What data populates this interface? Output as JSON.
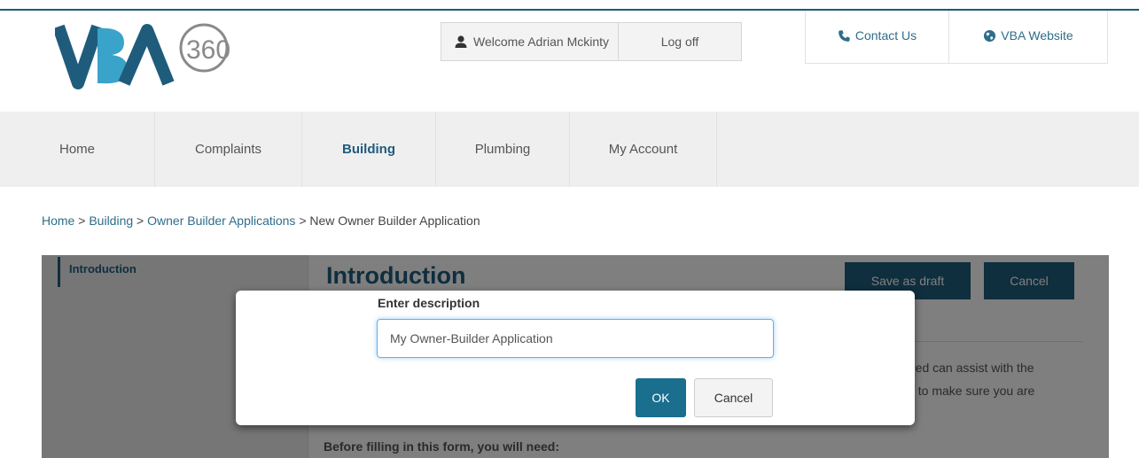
{
  "logo": {
    "text": "VBA",
    "suffix": "360",
    "colors": {
      "primary": "#1f5c7c",
      "secondary": "#3aa3c9",
      "ring": "#7a7a7a"
    }
  },
  "user": {
    "welcome": "Welcome Adrian Mckinty",
    "logoff": "Log off",
    "icon": "user-icon"
  },
  "toplinks": [
    {
      "label": "Contact Us",
      "icon": "phone-icon"
    },
    {
      "label": "VBA Website",
      "icon": "globe-icon"
    }
  ],
  "nav": [
    {
      "label": "Home",
      "active": false
    },
    {
      "label": "Complaints",
      "active": false
    },
    {
      "label": "Building",
      "active": true
    },
    {
      "label": "Plumbing",
      "active": false
    },
    {
      "label": "My Account",
      "active": false
    }
  ],
  "breadcrumb": {
    "items": [
      "Home",
      "Building",
      "Owner Builder Applications"
    ],
    "current": "New Owner Builder Application",
    "separator": ">"
  },
  "sidebar": {
    "items": [
      {
        "label": "Introduction"
      }
    ]
  },
  "content": {
    "title": "Introduction",
    "save_label": "Save as draft",
    "cancel_label": "Cancel",
    "para_line1": "red can assist with the",
    "para_line2": "t to make sure you are",
    "trail": "Before filling in this form, you will need:"
  },
  "modal": {
    "label": "Enter description",
    "input_value": "My Owner-Builder Application",
    "ok_label": "OK",
    "cancel_label": "Cancel"
  },
  "colors": {
    "accent": "#1f5c7c",
    "link": "#2f6d8a",
    "nav_bg": "#efefef"
  }
}
